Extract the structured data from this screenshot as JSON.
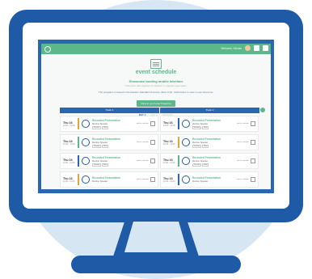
{
  "app": {
    "title": "event schedule",
    "welcome": "Welcome, Nicolas"
  },
  "hero": {
    "subtitle": "Showcase bootleg mobile interface",
    "subtitle2": "Cras justo odio dapibus ac facilisis in, egestas eget quam.",
    "text": "The programs is based in the Eastern Standard timezone (New York). Click below to view in your timezone.",
    "button": "View in your local Timezone"
  },
  "days": [
    {
      "label": "DAY 1"
    },
    {
      "label": "DAY 2"
    },
    {
      "label": "SESSION"
    }
  ],
  "tracks": [
    {
      "label": "Track 1"
    },
    {
      "label": "Track 2"
    }
  ],
  "rows": [
    {
      "cells": [
        {
          "date": "Thu 16",
          "time": "10:00 - 10:30",
          "title": "Recorded Presentation",
          "speaker": "Member Speaker",
          "tags": [
            "Session",
            "Main"
          ],
          "stripe": "#e8a23c",
          "add": "add to calendar"
        },
        {
          "date": "Thu 16",
          "time": "10:00 - 10:30",
          "title": "Recorded Presentation",
          "speaker": "Member Speaker",
          "tags": [
            "Session",
            "Main"
          ],
          "stripe": "#2a66b2",
          "add": "add to calendar"
        }
      ]
    },
    {
      "cells": [
        {
          "date": "Thu 16",
          "time": "10:30 - 11:00",
          "title": "Recorded Presentation",
          "speaker": "Member Speaker",
          "tags": [
            "Session",
            "Main"
          ],
          "stripe": "#5cb88a",
          "add": "add to calendar"
        },
        {
          "date": "Thu 16",
          "time": "10:30 - 11:00",
          "title": "Recorded Presentation",
          "speaker": "Member Speaker",
          "tags": [
            "Session",
            "Main"
          ],
          "stripe": "#e8a23c",
          "add": "add to calendar"
        }
      ]
    },
    {
      "cells": [
        {
          "date": "Thu 16",
          "time": "11:00 - 11:30",
          "title": "Recorded Presentation",
          "speaker": "Member Speaker",
          "tags": [
            "Session",
            "Main"
          ],
          "stripe": "#2a66b2",
          "add": "add to calendar"
        },
        {
          "date": "Thu 16",
          "time": "11:00 - 11:30",
          "title": "Recorded Presentation",
          "speaker": "Member Speaker",
          "tags": [
            "Session",
            "Main"
          ],
          "stripe": "#5cb88a",
          "add": "add to calendar"
        }
      ]
    },
    {
      "cells": [
        {
          "date": "Thu 16",
          "time": "11:30 - 12:00",
          "title": "Recorded Presentation",
          "speaker": "Member Speaker",
          "tags": [],
          "stripe": "#e8a23c",
          "add": "add to calendar"
        },
        {
          "date": "Thu 16",
          "time": "11:30 - 12:00",
          "title": "Recorded Presentation",
          "speaker": "Member Speaker",
          "tags": [],
          "stripe": "#2a66b2",
          "add": "add to calendar"
        }
      ]
    }
  ]
}
